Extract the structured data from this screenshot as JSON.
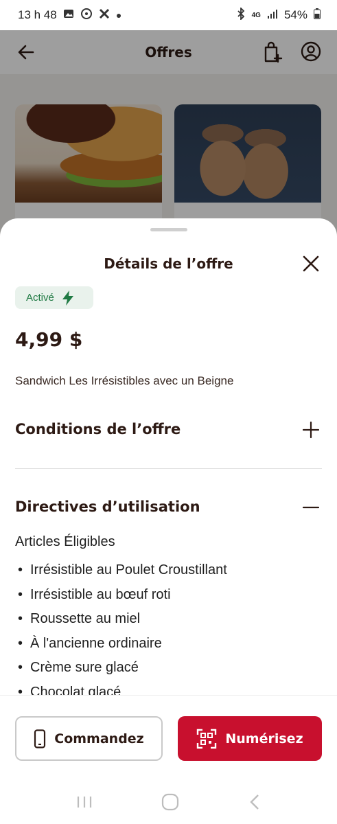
{
  "status_bar": {
    "time": "13 h 48",
    "network": "4G",
    "battery": "54%"
  },
  "header": {
    "title": "Offres"
  },
  "sheet": {
    "title": "Détails de l’offre",
    "badge": "Activé",
    "price": "4,99 $",
    "description": "Sandwich Les Irrésistibles avec un Beigne",
    "sections": [
      {
        "title": "Conditions de l’offre",
        "expanded": false
      },
      {
        "title": "Directives d’utilisation",
        "expanded": true
      }
    ],
    "eligible_heading": "Articles Éligibles",
    "eligible_items": [
      "Irrésistible au Poulet Croustillant",
      "Irrésistible au bœuf roti",
      "Roussette au miel",
      "À l'ancienne ordinaire",
      "Crème sure glacé",
      "Chocolat glacé"
    ]
  },
  "actions": {
    "order_label": "Commandez",
    "scan_label": "Numérisez"
  },
  "colors": {
    "brand_red": "#c8102e",
    "active_green": "#1f7a43",
    "text_dark": "#2d1a14"
  }
}
